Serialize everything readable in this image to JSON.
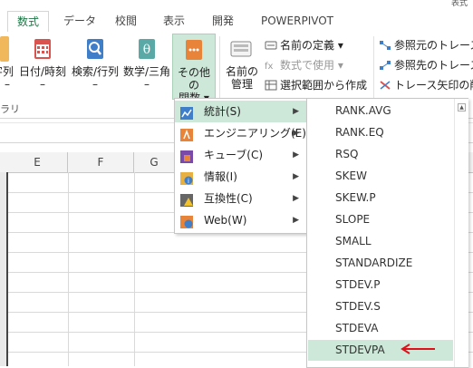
{
  "corner_text": "表式",
  "tabs": [
    {
      "label": "数式",
      "active": true
    },
    {
      "label": "データ"
    },
    {
      "label": "校閲"
    },
    {
      "label": "表示"
    },
    {
      "label": "開発"
    },
    {
      "label": "POWERPIVOT"
    }
  ],
  "ribbon": {
    "left_partial": {
      "line1": "字列",
      "line2": "–"
    },
    "datetime": {
      "line1": "日付/時刻",
      "line2": "–"
    },
    "lookup": {
      "line1": "検索/行列",
      "line2": "–"
    },
    "math": {
      "line1": "数学/三角",
      "line2": "–"
    },
    "more": {
      "line1": "その他の",
      "line2": "関数 ▾"
    },
    "names": {
      "line1": "名前の",
      "line2": "管理"
    },
    "define_name": "名前の定義 ▾",
    "use_in_formula": "数式で使用 ▾",
    "create_from_selection": "選択範囲から作成",
    "trace_precedents": "参照元のトレース",
    "trace_dependents": "参照先のトレース",
    "remove_arrows": "トレース矢印の削除",
    "group_label_partial": "ラリ"
  },
  "columns": [
    "E",
    "F",
    "G"
  ],
  "menu": [
    {
      "label": "統計(S)",
      "icon": "stats-icon",
      "highlighted": true
    },
    {
      "label": "エンジニアリング(E)",
      "icon": "engineering-icon"
    },
    {
      "label": "キューブ(C)",
      "icon": "cube-icon"
    },
    {
      "label": "情報(I)",
      "icon": "info-icon"
    },
    {
      "label": "互換性(C)",
      "icon": "compatibility-icon"
    },
    {
      "label": "Web(W)",
      "icon": "web-icon"
    }
  ],
  "submenu": [
    "RANK.AVG",
    "RANK.EQ",
    "RSQ",
    "SKEW",
    "SKEW.P",
    "SLOPE",
    "SMALL",
    "STANDARDIZE",
    "STDEV.P",
    "STDEV.S",
    "STDEVA",
    "STDEVPA"
  ],
  "submenu_highlight_index": 11,
  "colors": {
    "accent": "#217346",
    "highlight": "#cde8d8",
    "annotation_arrow": "#e0101a"
  }
}
